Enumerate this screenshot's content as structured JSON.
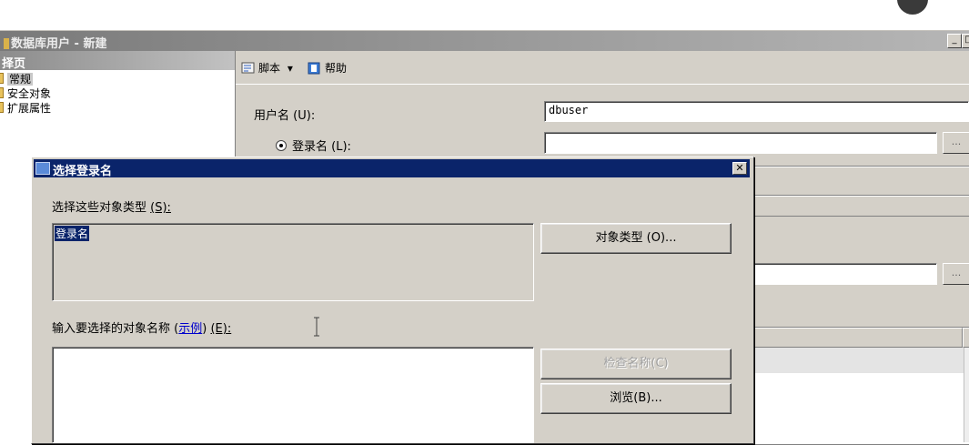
{
  "main_window": {
    "title": "数据库用户 - 新建",
    "minimize": "_",
    "maximize": "□",
    "left_pane": {
      "header": "择页",
      "pages": [
        "常规",
        "安全对象",
        "扩展属性"
      ]
    },
    "toolbar": {
      "script": "脚本",
      "dropdown": "▾",
      "help": "帮助"
    },
    "form": {
      "username_label": "用户名",
      "username_key": "(U):",
      "username_value": "dbuser",
      "login_label": "登录名",
      "login_key": "(L):",
      "login_value": "",
      "browse_ellipsis": "..."
    }
  },
  "dialog": {
    "title": "选择登录名",
    "close": "✕",
    "object_types_label": "选择这些对象类型",
    "object_types_key": "(S):",
    "object_types_value": "登录名",
    "object_types_button": "对象类型 (O)...",
    "enter_names_label": "输入要选择的对象名称",
    "examples_link": "示例",
    "enter_names_key": "(E):",
    "enter_names_value": "",
    "check_names_button": "检查名称(C)",
    "browse_button": "浏览(B)..."
  }
}
